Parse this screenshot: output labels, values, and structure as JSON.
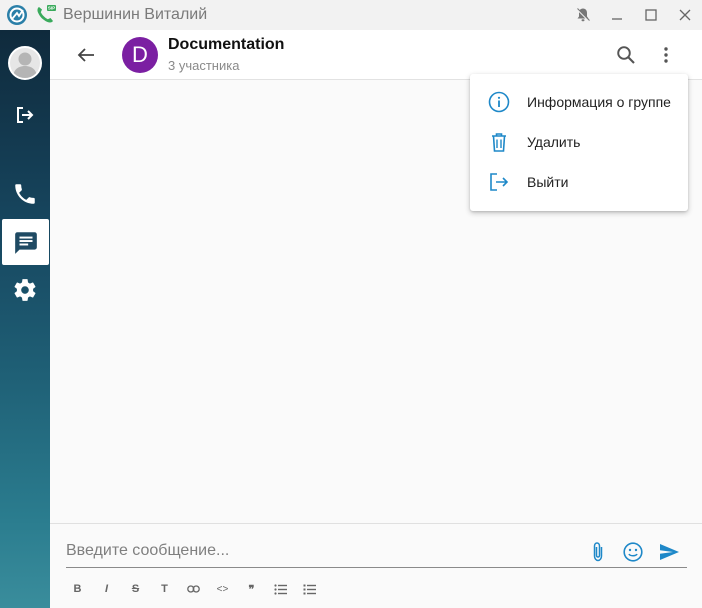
{
  "window": {
    "title": "Вершинин Виталий"
  },
  "colors": {
    "accent": "#1e88c8",
    "group_avatar": "#7b1fa2"
  },
  "sidebar": {
    "items": [
      {
        "name": "profile",
        "icon": "avatar-icon"
      },
      {
        "name": "logout",
        "icon": "logout-icon"
      },
      {
        "name": "calls",
        "icon": "phone-icon"
      },
      {
        "name": "chats",
        "icon": "chat-icon",
        "active": true
      },
      {
        "name": "settings",
        "icon": "gear-icon"
      }
    ]
  },
  "chat": {
    "avatar_letter": "D",
    "name": "Documentation",
    "subtitle": "3 участника"
  },
  "menu": {
    "items": [
      {
        "label": "Информация о группе",
        "icon": "info-icon"
      },
      {
        "label": "Удалить",
        "icon": "trash-icon"
      },
      {
        "label": "Выйти",
        "icon": "exit-icon"
      }
    ]
  },
  "composer": {
    "placeholder": "Введите сообщение...",
    "value": "",
    "format_buttons": [
      {
        "label": "B",
        "name": "bold"
      },
      {
        "label": "I",
        "name": "italic"
      },
      {
        "label": "S",
        "name": "strikethrough"
      },
      {
        "label": "T",
        "name": "heading"
      },
      {
        "label": "",
        "name": "link"
      },
      {
        "label": "<>",
        "name": "code"
      },
      {
        "label": "❞",
        "name": "quote"
      },
      {
        "label": "",
        "name": "bullet-list"
      },
      {
        "label": "",
        "name": "numbered-list"
      }
    ]
  }
}
